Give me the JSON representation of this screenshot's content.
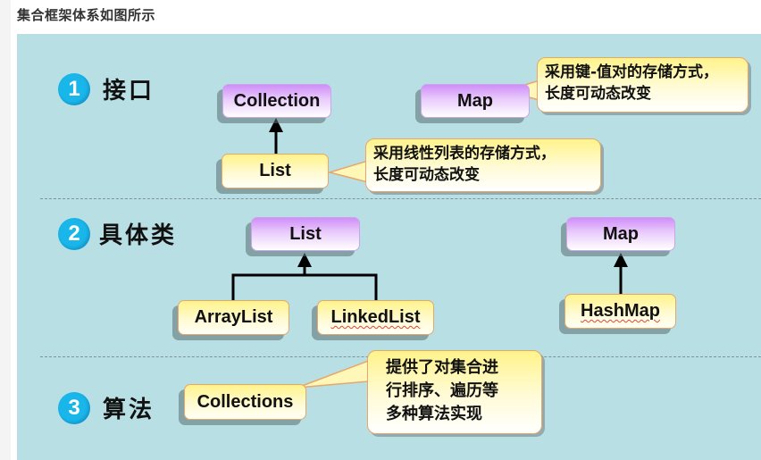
{
  "page": {
    "heading": "集合框架体系如图所示"
  },
  "sections": [
    {
      "number": "1",
      "title": "接口"
    },
    {
      "number": "2",
      "title": "具体类"
    },
    {
      "number": "3",
      "title": "算法"
    }
  ],
  "interfaces": {
    "collection": "Collection",
    "list": "List",
    "map": "Map"
  },
  "concrete": {
    "list": "List",
    "map": "Map",
    "arraylist": "ArrayList",
    "linkedlist": "LinkedList",
    "hashmap": "HashMap"
  },
  "algorithms": {
    "collections": "Collections"
  },
  "callouts": {
    "map": "采用键-值对的存储方式，\n长度可动态改变",
    "list": "采用线性列表的存储方式，\n长度可动态改变",
    "collections": "提供了对集合进\n行排序、遍历等\n多种算法实现"
  },
  "colors": {
    "background": "#b8dfe4",
    "badge": "#19b6ea",
    "interface_top": "#cf8ef8",
    "class_top": "#fff38a",
    "border_orange": "#e6a76b"
  }
}
